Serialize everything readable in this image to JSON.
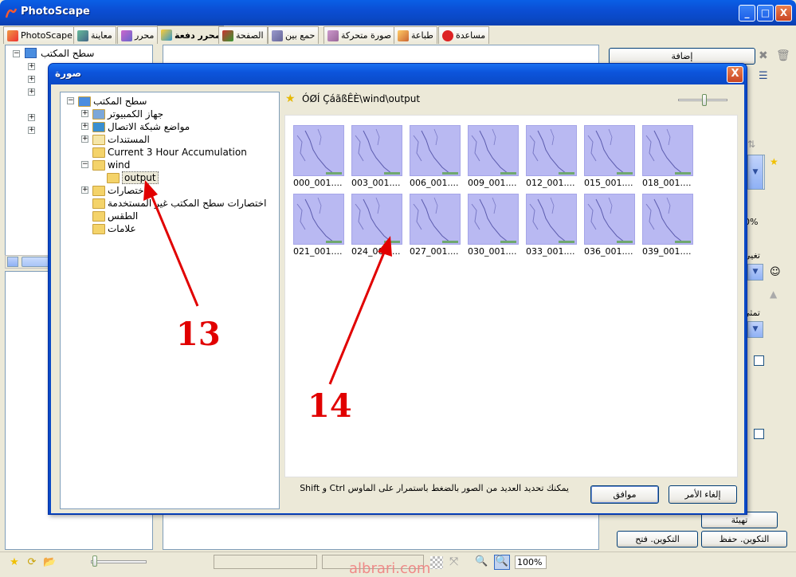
{
  "app": {
    "title": "PhotoScape"
  },
  "window_controls": {
    "minimize": "_",
    "maximize": "□",
    "close": "X"
  },
  "tabs": [
    {
      "label": "PhotoScape",
      "icon": "photoscape-icon"
    },
    {
      "label": "معاينة",
      "icon": "viewer-icon"
    },
    {
      "label": "محرر",
      "icon": "editor-icon"
    },
    {
      "label": "محرر دفعة",
      "icon": "batch-editor-icon",
      "active": true
    },
    {
      "label": "الصفحة",
      "icon": "page-icon"
    },
    {
      "label": "حمع بين",
      "icon": "combine-icon"
    },
    {
      "label": "صورة متحركة",
      "icon": "animated-gif-icon"
    },
    {
      "label": "طباعة",
      "icon": "print-icon"
    },
    {
      "label": "مساعدة",
      "icon": "help-icon"
    }
  ],
  "left_tree": {
    "root_label": "سطح المكتب"
  },
  "right_panel": {
    "add_button": "إضافة",
    "percent": "0%",
    "setup_button": "تهيئة",
    "compose_save": "التكوين. حفظ",
    "compose_open": "التكوين. فتح",
    "label_1": "تغيي",
    "label_2": "تمثي"
  },
  "status": {
    "zoom": "100%"
  },
  "watermark": "albrari.com",
  "dialog": {
    "title": "صورة",
    "close": "X",
    "path": "ÓØÍ ÇáãßÊÈ\\wind\\output",
    "hint": "يمكنك تحديد العديد من الصور بالضغط باستمرار على الماوس Ctrl و Shift",
    "cancel_button": "إلغاء الأمر",
    "ok_button": "موافق",
    "tree": [
      {
        "label": "سطح المكتب",
        "level": 0,
        "expander": "−",
        "icon": "desktop-icon"
      },
      {
        "label": "جهاز الكمبيوتر",
        "level": 1,
        "expander": "+",
        "icon": "my-computer-icon"
      },
      {
        "label": "مواضع شبكة الاتصال",
        "level": 1,
        "expander": "+",
        "icon": "network-places-icon"
      },
      {
        "label": "المستندات",
        "level": 1,
        "expander": "+",
        "icon": "documents-icon"
      },
      {
        "label": "Current 3 Hour Accumulation",
        "level": 1,
        "expander": "",
        "icon": "folder-icon"
      },
      {
        "label": "wind",
        "level": 1,
        "expander": "−",
        "icon": "folder-icon"
      },
      {
        "label": "output",
        "level": 2,
        "expander": "",
        "icon": "folder-open-icon",
        "selected": true
      },
      {
        "label": "اختصارات",
        "level": 1,
        "expander": "+",
        "icon": "folder-icon"
      },
      {
        "label": "اختصارات سطح المكتب غير المستخدمة",
        "level": 1,
        "expander": "",
        "icon": "folder-icon"
      },
      {
        "label": "الطقس",
        "level": 1,
        "expander": "",
        "icon": "folder-icon"
      },
      {
        "label": "علامات",
        "level": 1,
        "expander": "",
        "icon": "folder-icon"
      }
    ],
    "thumbnails": [
      "000_001....",
      "003_001....",
      "006_001....",
      "009_001....",
      "012_001....",
      "015_001....",
      "018_001....",
      "021_001....",
      "024_001....",
      "027_001....",
      "030_001....",
      "033_001....",
      "036_001....",
      "039_001...."
    ]
  },
  "annotations": {
    "label_13": "13",
    "label_14": "14"
  }
}
